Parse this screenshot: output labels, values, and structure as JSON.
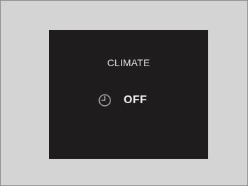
{
  "screen": {
    "title": "CLIMATE",
    "status": "OFF",
    "icon": "clock-icon"
  },
  "colors": {
    "frame_background": "#d4d4d4",
    "screen_background": "#1f1c1d",
    "text": "#e6e6e6",
    "icon": "#a9a9a9"
  }
}
